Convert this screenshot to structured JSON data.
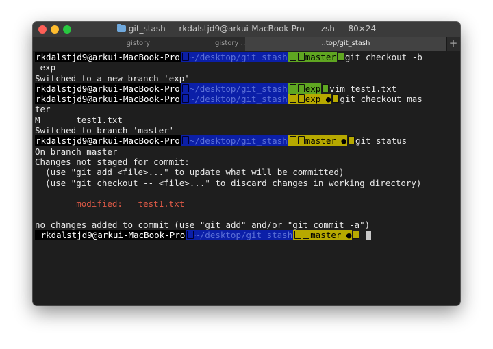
{
  "window": {
    "title": "git_stash — rkdalstjd9@arkui-MacBook-Pro — -zsh — 80×24",
    "tabs": [
      {
        "label": "gistory"
      },
      {
        "label": "gistory …"
      },
      {
        "label": "..top/git_stash"
      }
    ],
    "add_tab": "+"
  },
  "terminal": {
    "user_host": "rkdalstjd9@arkui-MacBook-Pro",
    "path": "~/desktop/git_stash",
    "line1_branch": "master",
    "line1_cmd": "git checkout -b",
    "line2": "exp",
    "line3": "Switched to a new branch 'exp'",
    "line4_branch": "exp",
    "line4_cmd": "vim test1.txt",
    "line5_branch": "exp ●",
    "line5_cmd": "git checkout mas",
    "line6": "ter",
    "line7_flag": "M",
    "line7_file": "test1.txt",
    "line8": "Switched to branch 'master'",
    "line9_branch": "master ●",
    "line9_cmd": "git status",
    "line10": "On branch master",
    "line11": "Changes not staged for commit:",
    "line12": "  (use \"git add <file>...\" to update what will be committed)",
    "line13": "  (use \"git checkout -- <file>...\" to discard changes in working directory)",
    "line14_label": "modified:",
    "line14_file": "test1.txt",
    "line15": "no changes added to commit (use \"git add\" and/or \"git commit -a\")",
    "line16_branch": "master ●"
  },
  "colors": {
    "path_segment": "#0b1fa8",
    "clean_branch": "#5fa621",
    "dirty_branch": "#b7a900",
    "modified_text": "#e05a47"
  }
}
